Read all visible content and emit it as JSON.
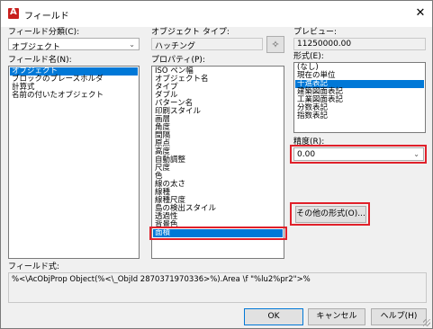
{
  "window": {
    "title": "フィールド"
  },
  "left": {
    "category_label": "フィールド分類(C):",
    "category_value": "オブジェクト",
    "names_label": "フィールド名(N):",
    "names": [
      "オブジェクト",
      "ブロックのプレースホルダ",
      "計算式",
      "名前の付いたオブジェクト"
    ],
    "names_selected": 0
  },
  "middle": {
    "object_type_label": "オブジェクト タイプ:",
    "object_type_value": "ハッチング",
    "property_label": "プロパティ(P):",
    "properties": [
      "ISO ペン幅",
      "オブジェクト名",
      "タイプ",
      "ダブル",
      "パターン名",
      "印刷スタイル",
      "画層",
      "角度",
      "間隔",
      "原点",
      "高度",
      "自動調整",
      "尺度",
      "色",
      "線の太さ",
      "線種",
      "線種尺度",
      "島の検出スタイル",
      "透過性",
      "背景色",
      "面積"
    ],
    "properties_selected": 20
  },
  "right": {
    "preview_label": "プレビュー:",
    "preview_value": "11250000.00",
    "format_label": "形式(E):",
    "formats": [
      "(なし)",
      "現在の単位",
      "十進表記",
      "建築図面表記",
      "工業図面表記",
      "分数表記",
      "指数表記"
    ],
    "formats_selected": 2,
    "precision_label": "精度(R):",
    "precision_value": "0.00",
    "other_format_button": "その他の形式(O)..."
  },
  "field_expression": {
    "label": "フィールド式:",
    "value": "%<\\AcObjProp Object(%<\\_ObjId 2870371970336>%).Area \\f \"%lu2%pr2\">%"
  },
  "buttons": {
    "ok": "OK",
    "cancel": "キャンセル",
    "help": "ヘルプ(H)"
  }
}
